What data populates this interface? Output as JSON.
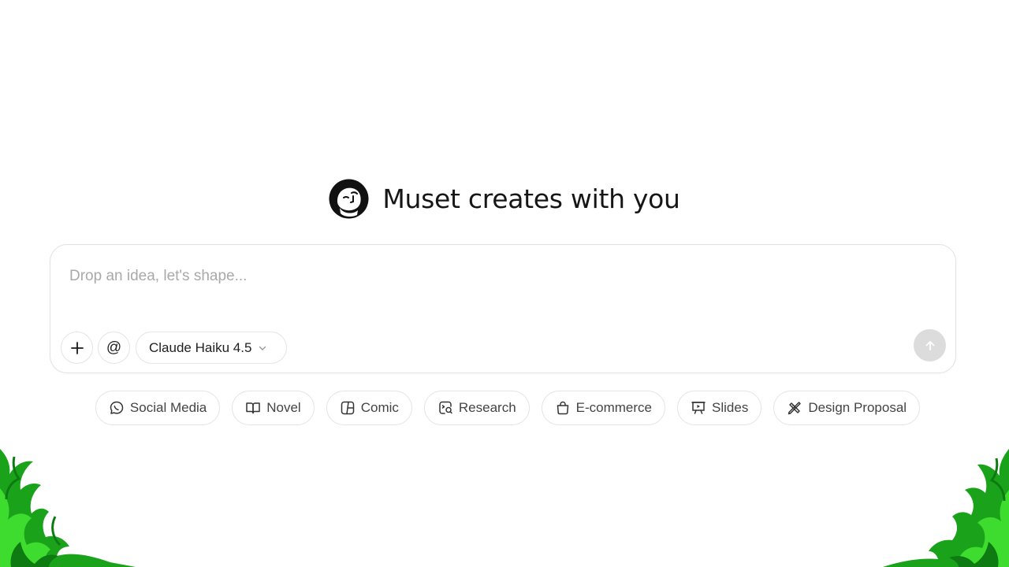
{
  "hero": {
    "title": "Muset creates with you",
    "logo_icon": "muset-face-logo-icon"
  },
  "composer": {
    "placeholder": "Drop an idea, let's shape...",
    "value": "",
    "add_icon": "plus-icon",
    "mention_label": "@",
    "model": {
      "label": "Claude Haiku 4.5",
      "icon": "chevron-down-icon"
    },
    "send_icon": "arrow-up-icon",
    "send_color": "#dcdcdc"
  },
  "chips": [
    {
      "label": "Social Media",
      "icon": "chat-bubble-icon"
    },
    {
      "label": "Novel",
      "icon": "open-book-icon"
    },
    {
      "label": "Comic",
      "icon": "comic-panel-icon"
    },
    {
      "label": "Research",
      "icon": "research-magnifier-icon"
    },
    {
      "label": "E-commerce",
      "icon": "shopping-bag-icon"
    },
    {
      "label": "Slides",
      "icon": "presentation-icon"
    },
    {
      "label": "Design Proposal",
      "icon": "design-tools-icon"
    }
  ],
  "decoration": {
    "flame_colors": [
      "#1aa31a",
      "#3ddc2f",
      "#0d7a12"
    ]
  }
}
